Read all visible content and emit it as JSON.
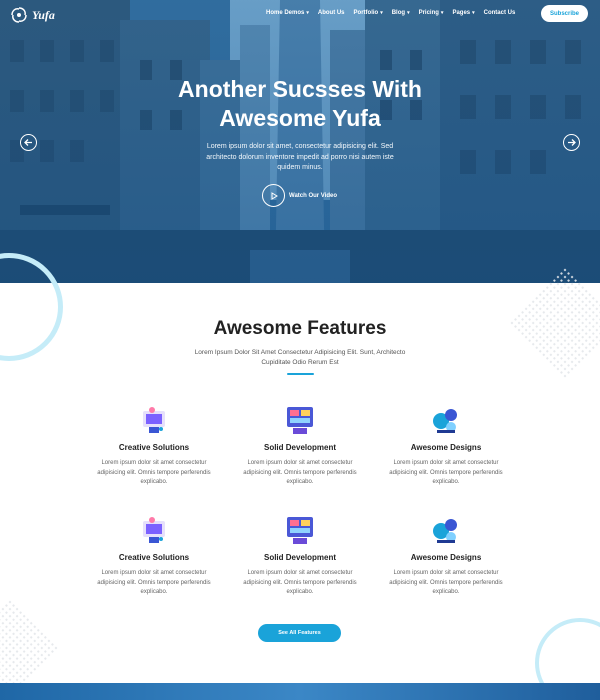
{
  "brand": {
    "name": "Yufa"
  },
  "nav": {
    "items": [
      {
        "label": "Home Demos",
        "caret": true
      },
      {
        "label": "About Us",
        "caret": false
      },
      {
        "label": "Portfolio",
        "caret": true
      },
      {
        "label": "Blog",
        "caret": true
      },
      {
        "label": "Pricing",
        "caret": true
      },
      {
        "label": "Pages",
        "caret": true
      },
      {
        "label": "Contact Us",
        "caret": false
      }
    ],
    "subscribe_label": "Subscribe"
  },
  "hero": {
    "title_line1": "Another Sucsses With",
    "title_line2": "Awesome Yufa",
    "text": "Lorem ipsum dolor sit amet, consectetur adipisicing elit. Sed architecto dolorum inventore impedit ad porro nisi autem iste quidem minus.",
    "video_label": "Watch Our Video"
  },
  "features": {
    "title": "Awesome Features",
    "subtitle": "Lorem Ipsum Dolor Sit Amet Consectetur Adipisicing Elit. Sunt, Architecto Cupiditate Odio Rerum Est",
    "cards": [
      {
        "title": "Creative Solutions",
        "text": "Lorem ipsum dolor sit amet consectetur adipisicing elit. Omnis tempore perferendis explicabo.",
        "icon": "creative-solutions-icon"
      },
      {
        "title": "Solid Development",
        "text": "Lorem ipsum dolor sit amet consectetur adipisicing elit. Omnis tempore perferendis explicabo.",
        "icon": "solid-development-icon"
      },
      {
        "title": "Awesome Designs",
        "text": "Lorem ipsum dolor sit amet consectetur adipisicing elit. Omnis tempore perferendis explicabo.",
        "icon": "awesome-designs-icon"
      },
      {
        "title": "Creative Solutions",
        "text": "Lorem ipsum dolor sit amet consectetur adipisicing elit. Omnis tempore perferendis explicabo.",
        "icon": "creative-solutions-icon"
      },
      {
        "title": "Solid Development",
        "text": "Lorem ipsum dolor sit amet consectetur adipisicing elit. Omnis tempore perferendis explicabo.",
        "icon": "solid-development-icon"
      },
      {
        "title": "Awesome Designs",
        "text": "Lorem ipsum dolor sit amet consectetur adipisicing elit. Omnis tempore perferendis explicabo.",
        "icon": "awesome-designs-icon"
      }
    ],
    "cta_label": "See All Features"
  },
  "colors": {
    "accent": "#1aa3d9",
    "hero_overlay": "#2c6fa3",
    "heading": "#222222",
    "ring": "#c5ecf8"
  }
}
